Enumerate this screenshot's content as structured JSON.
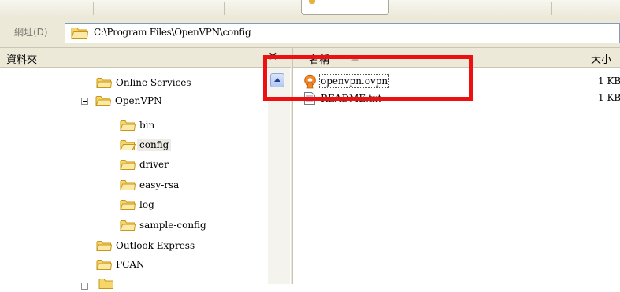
{
  "address_bar": {
    "label": "網址(D)",
    "path": "C:\\Program Files\\OpenVPN\\config"
  },
  "folders_pane": {
    "title": "資料夾",
    "close_glyph": "×",
    "tree": [
      {
        "label": "Online Services",
        "expander": false,
        "selected": false
      },
      {
        "label": "OpenVPN",
        "expander": true,
        "selected": false
      },
      {
        "label": "bin",
        "expander": false,
        "selected": false
      },
      {
        "label": "config",
        "expander": false,
        "selected": true
      },
      {
        "label": "driver",
        "expander": false,
        "selected": false
      },
      {
        "label": "easy-rsa",
        "expander": false,
        "selected": false
      },
      {
        "label": "log",
        "expander": false,
        "selected": false
      },
      {
        "label": "sample-config",
        "expander": false,
        "selected": false
      },
      {
        "label": "Outlook Express",
        "expander": false,
        "selected": false
      },
      {
        "label": "PCAN",
        "expander": false,
        "selected": false
      }
    ]
  },
  "file_list": {
    "columns": {
      "name": "名稱",
      "size": "大小"
    },
    "files": [
      {
        "name": "openvpn.ovpn",
        "size": "1 KB",
        "icon": "openvpn-config-icon"
      },
      {
        "name": "README.txt",
        "size": "1 KB",
        "icon": "text-file-icon"
      }
    ]
  },
  "colors": {
    "highlight": "#ee1010",
    "folder": "#f2c94c",
    "chrome": "#ece9d8"
  }
}
